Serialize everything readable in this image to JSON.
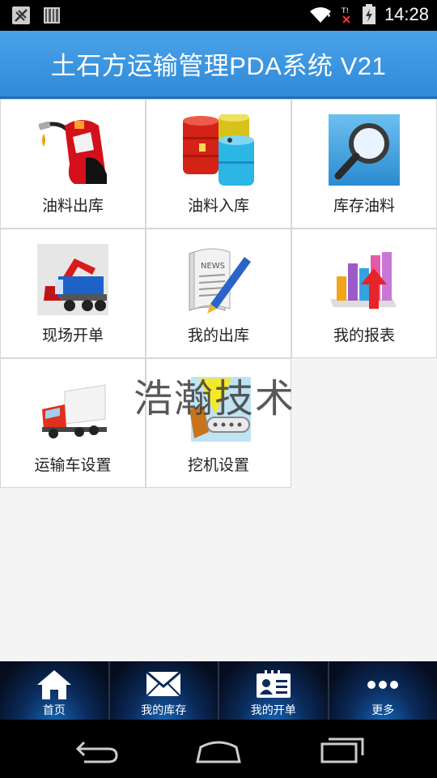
{
  "status_bar": {
    "time": "14:28"
  },
  "header": {
    "title": "土石方运输管理PDA系统 V21"
  },
  "grid_items": [
    {
      "label": "油料出库",
      "icon": "fuel-pump-icon"
    },
    {
      "label": "油料入库",
      "icon": "oil-barrels-icon"
    },
    {
      "label": "库存油料",
      "icon": "magnifier-icon"
    },
    {
      "label": "现场开单",
      "icon": "excavator-truck-icon"
    },
    {
      "label": "我的出库",
      "icon": "newspaper-pen-icon"
    },
    {
      "label": "我的报表",
      "icon": "bar-chart-icon"
    },
    {
      "label": "运输车设置",
      "icon": "red-truck-icon"
    },
    {
      "label": "挖机设置",
      "icon": "settings-card-icon"
    }
  ],
  "watermark": "浩瀚技术",
  "tabs": [
    {
      "label": "首页",
      "icon": "home-icon"
    },
    {
      "label": "我的库存",
      "icon": "envelope-icon"
    },
    {
      "label": "我的开单",
      "icon": "id-card-icon"
    },
    {
      "label": "更多",
      "icon": "more-dots-icon"
    }
  ],
  "colors": {
    "header_blue": "#3a96e0",
    "tabbar_dark": "#07122a",
    "grid_border": "#d6d6d6"
  }
}
